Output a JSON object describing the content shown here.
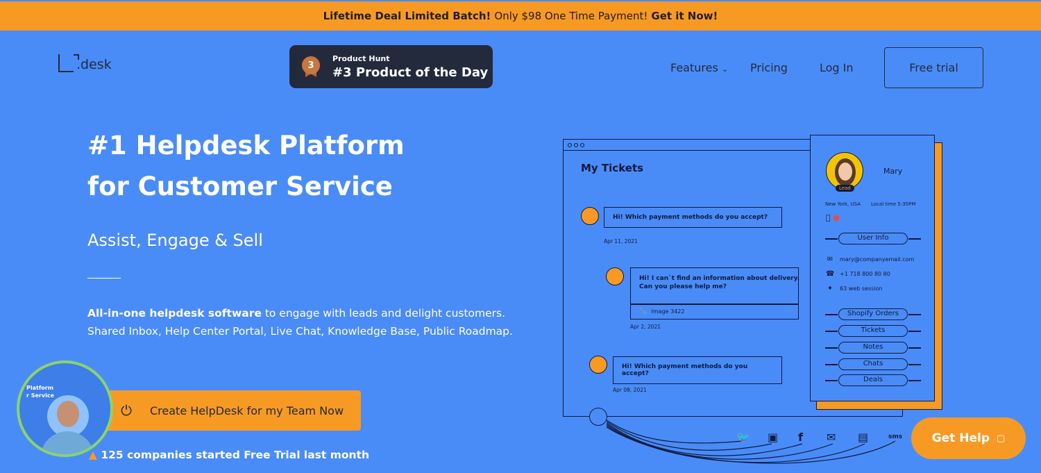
{
  "promo": {
    "bold1": "Lifetime Deal Limited Batch!",
    "mid": "Only $98 One Time Payment!",
    "bold2": "Get it Now!"
  },
  "logo": {
    "text": ".desk"
  },
  "product_hunt": {
    "badge_num": "3",
    "small": "Product Hunt",
    "big": "#3 Product of the Day"
  },
  "nav": {
    "features": "Features",
    "pricing": "Pricing",
    "login": "Log In",
    "free_trial": "Free trial"
  },
  "hero": {
    "line1": "#1 Helpdesk Platform",
    "line2": "for Customer Service",
    "sub": "Assist, Engage & Sell",
    "desc_bold": "All-in-one helpdesk software",
    "desc_rest": " to engage with leads and delight customers.",
    "desc_line2": "Shared Inbox, Help Center Portal, Live Chat, Knowledge Base, Public Roadmap.",
    "cta": "Create HelpDesk for my Team Now",
    "companies": "125 companies started Free Trial last month"
  },
  "video": {
    "text": "Platform\nr Service"
  },
  "illustration": {
    "title": "My Tickets",
    "t1": "Hi! Which payment methods do you accept?",
    "d1": "Apr 11, 2021",
    "t2": "Hi! I can`t find an information about delivery.\nCan you please help me?",
    "attach": "Image 3422",
    "d2": "Apr 2, 2021",
    "t3": "Hi! Which payment methods do you accept?",
    "d3": "Apr 08, 2021",
    "name": "Mary",
    "lead": "Lead",
    "location": "New York, USA",
    "local_time": "Local time 5:35PM",
    "user_info": "User Info",
    "email": "mary@companyemail.com",
    "phone": "+1 718 800 80 80",
    "sessions": "63 web session",
    "buttons": [
      "Shopify Orders",
      "Tickets",
      "Notes",
      "Chats",
      "Deals"
    ],
    "sms": "sms"
  },
  "get_help": "Get Help"
}
